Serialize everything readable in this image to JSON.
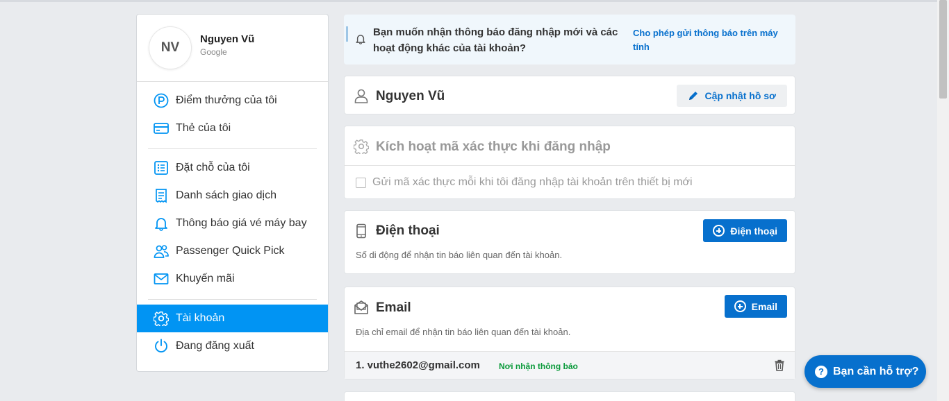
{
  "profile": {
    "initials": "NV",
    "name": "Nguyen Vũ",
    "provider": "Google"
  },
  "sidebar": {
    "items": [
      {
        "label": "Điểm thưởng của tôi",
        "icon": "points-icon"
      },
      {
        "label": "Thẻ của tôi",
        "icon": "card-icon"
      },
      {
        "label": "Đặt chỗ của tôi",
        "icon": "booking-list-icon"
      },
      {
        "label": "Danh sách giao dịch",
        "icon": "receipt-icon"
      },
      {
        "label": "Thông báo giá vé máy bay",
        "icon": "bell-icon"
      },
      {
        "label": "Passenger Quick Pick",
        "icon": "users-icon"
      },
      {
        "label": "Khuyến mãi",
        "icon": "mail-icon"
      },
      {
        "label": "Tài khoản",
        "icon": "gear-icon"
      },
      {
        "label": "Đang đăng xuất",
        "icon": "power-icon"
      }
    ],
    "active_item": "Tài khoản"
  },
  "notice": {
    "text": "Bạn muốn nhận thông báo đăng nhập mới và các hoạt động khác của tài khoản?",
    "link": "Cho phép gửi thông báo trên máy tính"
  },
  "profile_card": {
    "name": "Nguyen Vũ",
    "button": "Cập nhật hồ sơ"
  },
  "auth_card": {
    "title": "Kích hoạt mã xác thực khi đăng nhập",
    "checkbox_label": "Gửi mã xác thực mỗi khi tôi đăng nhập tài khoản trên thiết bị mới"
  },
  "phone_card": {
    "title": "Điện thoại",
    "button": "Điện thoại",
    "description": "Số di động để nhận tin báo liên quan đến tài khoản."
  },
  "email_card": {
    "title": "Email",
    "button": "Email",
    "description": "Địa chỉ email để nhận tin báo liên quan đến tài khoản.",
    "entries": [
      {
        "address": "1. vuthe2602@gmail.com",
        "tag": "Nơi nhận thông báo"
      }
    ]
  },
  "help_button": {
    "label": "Bạn cần hỗ trợ?"
  },
  "colors": {
    "accent": "#0194f3",
    "button_blue": "#0770cd",
    "tag_green": "#0a9a3a"
  }
}
